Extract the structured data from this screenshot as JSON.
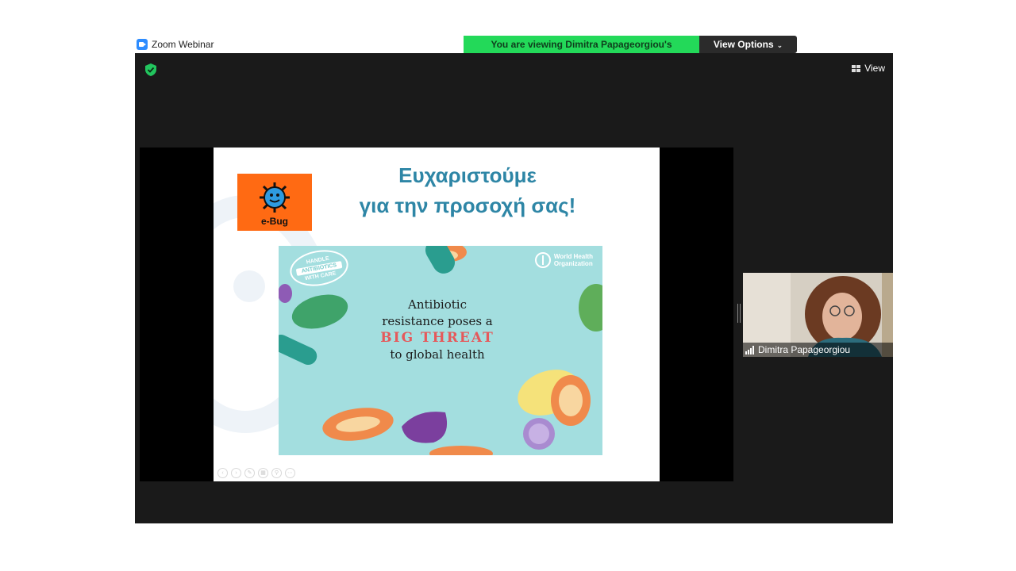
{
  "app": {
    "title": "Zoom Webinar",
    "accent_color": "#2D8CFF"
  },
  "banner": {
    "viewing_text": "You are viewing Dimitra Papageorgiou's screen",
    "view_options_label": "View Options",
    "green_color": "#23D959"
  },
  "toolbar": {
    "view_label": "View",
    "security_icon": "shield-check-icon"
  },
  "slide": {
    "title_line1": "Ευχαριστούμε",
    "title_line2": "για την προσοχή σας!",
    "logo_text": "e-Bug",
    "poster": {
      "line1": "Antibiotic",
      "line2": "resistance poses a",
      "line3": "BIG THREAT",
      "line4": "to global health",
      "org_line1": "World Health",
      "org_line2": "Organization",
      "stamp_top": "HANDLE",
      "stamp_mid": "ANTIBIOTICS",
      "stamp_bottom": "WITH CARE"
    }
  },
  "participant": {
    "name": "Dimitra Papageorgiou"
  }
}
